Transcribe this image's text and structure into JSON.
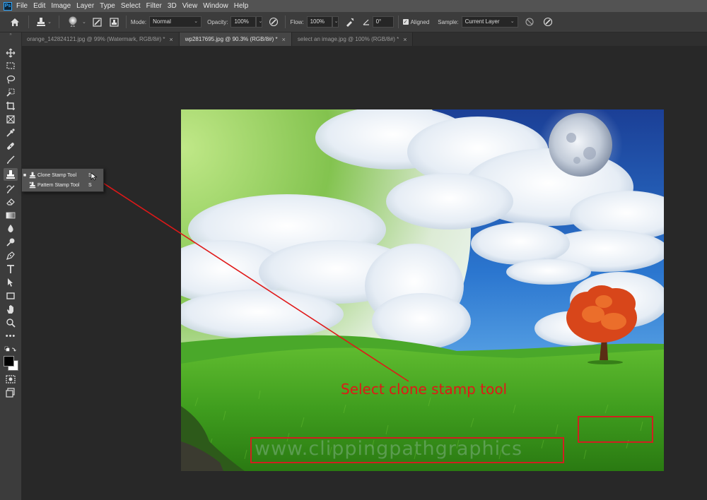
{
  "app": {
    "logo": "Ps"
  },
  "menu": [
    "File",
    "Edit",
    "Image",
    "Layer",
    "Type",
    "Select",
    "Filter",
    "3D",
    "View",
    "Window",
    "Help"
  ],
  "options": {
    "brush_size": "21",
    "mode_label": "Mode:",
    "mode_value": "Normal",
    "opacity_label": "Opacity:",
    "opacity_value": "100%",
    "flow_label": "Flow:",
    "flow_value": "100%",
    "angle_value": "0°",
    "aligned_label": "Aligned",
    "aligned_checked": true,
    "sample_label": "Sample:",
    "sample_value": "Current Layer"
  },
  "tabs": [
    {
      "label": "orange_142824121.jpg @ 99% (Watermark, RGB/8#) *",
      "active": false
    },
    {
      "label": "wp2817695.jpg @ 90.3% (RGB/8#) *",
      "active": true
    },
    {
      "label": "select an image.jpg @ 100% (RGB/8#) *",
      "active": false
    }
  ],
  "tab_close_glyph": "×",
  "flyout": {
    "items": [
      {
        "marker": "■",
        "label": "Clone Stamp Tool",
        "shortcut": "S"
      },
      {
        "marker": "",
        "label": "Pattern Stamp Tool",
        "shortcut": "S"
      }
    ]
  },
  "annotation": {
    "text": "Select clone stamp tool",
    "color": "#e01818"
  },
  "watermark": {
    "text": "www.clippingpathgraphics"
  },
  "colors": {
    "accent_red": "#d02020",
    "panel": "#3c3c3c",
    "workspace": "#282828"
  },
  "tool_icons": [
    "move-icon",
    "marquee-icon",
    "lasso-icon",
    "quick-select-icon",
    "crop-icon",
    "frame-icon",
    "eyedropper-icon",
    "healing-icon",
    "brush-icon",
    "clone-stamp-icon",
    "history-brush-icon",
    "eraser-icon",
    "gradient-icon",
    "blur-icon",
    "dodge-icon",
    "pen-icon",
    "type-icon",
    "path-select-icon",
    "rectangle-icon",
    "hand-icon",
    "zoom-icon",
    "more-tools-icon",
    "default-colors-icon",
    "color-swatches-icon",
    "quick-mask-icon",
    "screen-mode-icon"
  ]
}
